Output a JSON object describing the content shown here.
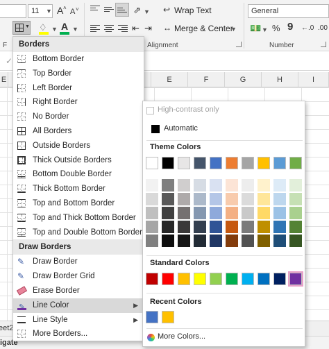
{
  "ribbon": {
    "font_size": "11",
    "grow_font": "A",
    "shrink_font": "A",
    "wrap_text": "Wrap Text",
    "merge_center": "Merge & Center",
    "number_format": "General",
    "percent": "%",
    "comma": "9",
    "alignment_label": "Alignment",
    "number_label": "Number",
    "font_label_fragment": "F"
  },
  "sheet": {
    "columns": [
      "E",
      "E",
      "F",
      "G",
      "H",
      "I"
    ],
    "row_header_fragment": "E",
    "tab_fragment": "eet2",
    "status_fragment": "igate"
  },
  "borders_menu": {
    "header1": "Borders",
    "items": [
      {
        "label": "Bottom Border",
        "icon": "border-bottom-icon"
      },
      {
        "label": "Top Border",
        "icon": "border-top-icon"
      },
      {
        "label": "Left Border",
        "icon": "border-left-icon"
      },
      {
        "label": "Right Border",
        "icon": "border-right-icon"
      },
      {
        "label": "No Border",
        "icon": "no-border-icon"
      },
      {
        "label": "All Borders",
        "icon": "all-borders-icon"
      },
      {
        "label": "Outside Borders",
        "icon": "outside-borders-icon"
      },
      {
        "label": "Thick Outside Borders",
        "icon": "thick-outside-borders-icon"
      },
      {
        "label": "Bottom Double Border",
        "icon": "bottom-double-border-icon"
      },
      {
        "label": "Thick Bottom Border",
        "icon": "thick-bottom-border-icon"
      },
      {
        "label": "Top and Bottom Border",
        "icon": "top-bottom-border-icon"
      },
      {
        "label": "Top and Thick Bottom Border",
        "icon": "top-thick-bottom-border-icon"
      },
      {
        "label": "Top and Double Bottom Border",
        "icon": "top-double-bottom-border-icon"
      }
    ],
    "header2": "Draw Borders",
    "draw_items": [
      {
        "label": "Draw Border",
        "icon": "pencil-icon"
      },
      {
        "label": "Draw Border Grid",
        "icon": "pencil-grid-icon"
      },
      {
        "label": "Erase Border",
        "icon": "eraser-icon"
      },
      {
        "label": "Line Color",
        "icon": "line-color-icon",
        "submenu": true,
        "active": true
      },
      {
        "label": "Line Style",
        "icon": "line-style-icon",
        "submenu": true
      },
      {
        "label": "More Borders...",
        "icon": "more-borders-icon"
      }
    ]
  },
  "color_menu": {
    "high_contrast": "High-contrast only",
    "automatic": "Automatic",
    "theme_colors_label": "Theme Colors",
    "standard_colors_label": "Standard Colors",
    "recent_colors_label": "Recent Colors",
    "more_colors": "More Colors...",
    "theme_colors": [
      "#FFFFFF",
      "#000000",
      "#E7E6E6",
      "#44546A",
      "#4472C4",
      "#ED7D31",
      "#A5A5A5",
      "#FFC000",
      "#5B9BD5",
      "#70AD47"
    ],
    "theme_tints": [
      [
        "#F2F2F2",
        "#7F7F7F",
        "#D0CECE",
        "#D6DCE4",
        "#D9E1F2",
        "#FCE4D6",
        "#EDEDED",
        "#FFF2CC",
        "#DDEBF7",
        "#E2EFDA"
      ],
      [
        "#D9D9D9",
        "#595959",
        "#AEAAAA",
        "#ACB9CA",
        "#B4C6E7",
        "#F8CBAD",
        "#DBDBDB",
        "#FFE699",
        "#BDD7EE",
        "#C6E0B4"
      ],
      [
        "#BFBFBF",
        "#404040",
        "#757171",
        "#8497B0",
        "#8EA9DB",
        "#F4B084",
        "#C9C9C9",
        "#FFD966",
        "#9BC2E6",
        "#A9D08E"
      ],
      [
        "#A6A6A6",
        "#262626",
        "#3A3838",
        "#333F4F",
        "#305496",
        "#C65911",
        "#7B7B7B",
        "#BF8F00",
        "#2F75B5",
        "#548235"
      ],
      [
        "#808080",
        "#0D0D0D",
        "#161616",
        "#222B35",
        "#203764",
        "#833C0C",
        "#525252",
        "#806000",
        "#1F4E78",
        "#375623"
      ]
    ],
    "standard_colors": [
      "#C00000",
      "#FF0000",
      "#FFC000",
      "#FFFF00",
      "#92D050",
      "#00B050",
      "#00B0F0",
      "#0070C0",
      "#002060",
      "#7030A0"
    ],
    "recent_colors": [
      "#4472C4",
      "#FFC000"
    ]
  }
}
